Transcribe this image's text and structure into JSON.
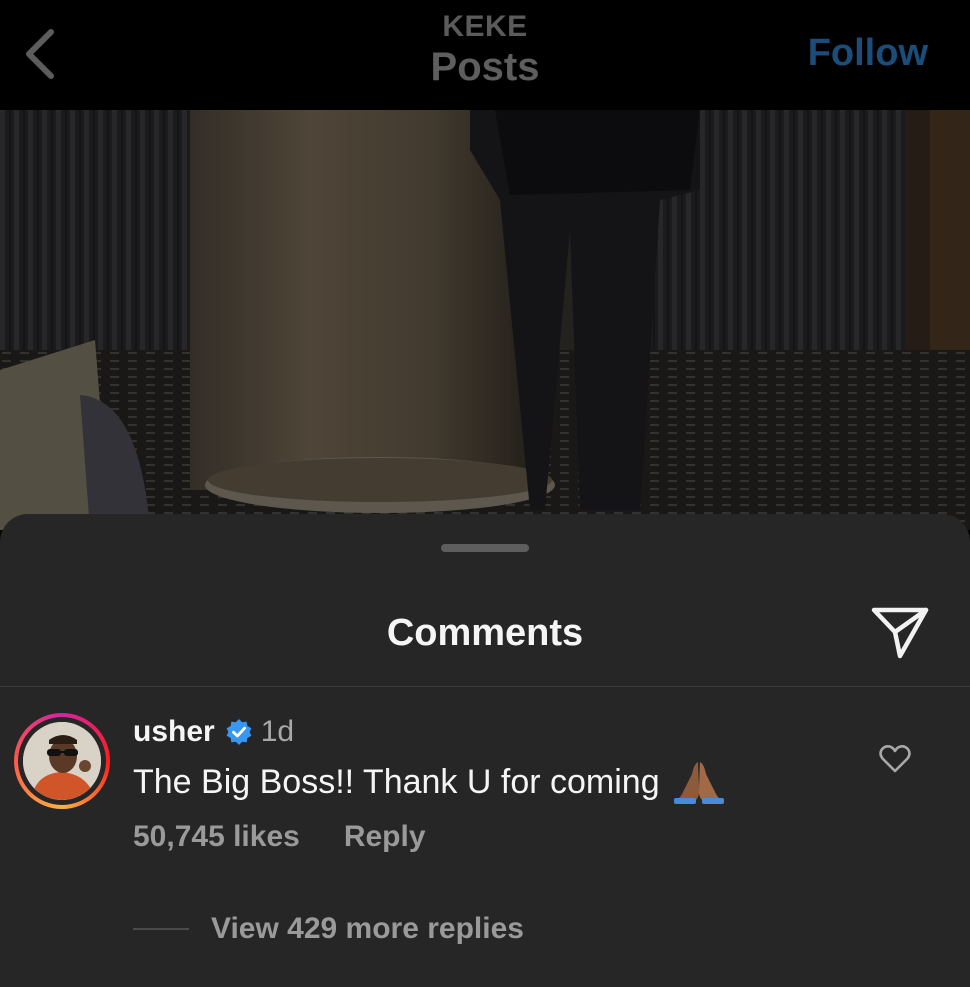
{
  "header": {
    "account": "KEKE",
    "title": "Posts",
    "follow_label": "Follow"
  },
  "comments_sheet": {
    "title": "Comments"
  },
  "comment": {
    "username": "usher",
    "time": "1d",
    "text": "The Big Boss!! Thank U for coming",
    "emoji": "folded-hands-emoji",
    "likes": "50,745 likes",
    "reply_label": "Reply",
    "view_replies": "View 429 more replies"
  },
  "colors": {
    "follow": "#1b4d7a",
    "verified": "#3897f0",
    "sheet_bg": "#262626"
  }
}
